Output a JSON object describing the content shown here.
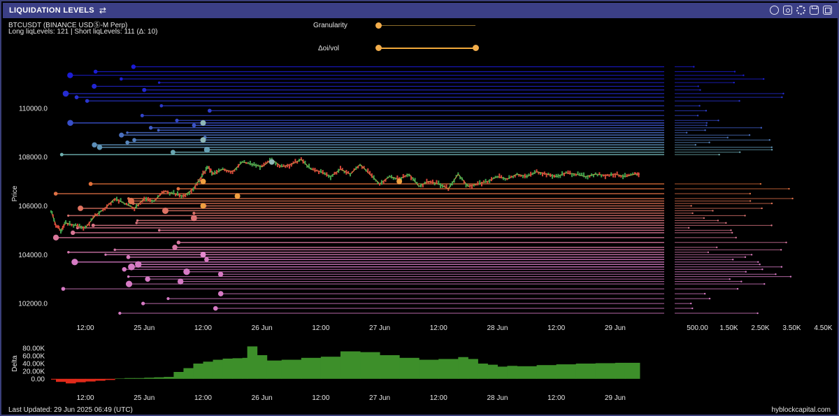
{
  "header": {
    "title": "LIQUIDATION LEVELS",
    "symbol": "BTCUSDT (BINANCE USDⓈ-M Perp)",
    "levels_summary": "Long liqLevels: 121 | Short liqLevels: 111 (Δ: 10)",
    "toolbar_icons": [
      "refresh-icon",
      "camera-icon",
      "gear-icon",
      "save-icon",
      "fullscreen-icon"
    ]
  },
  "controls": {
    "granularity_label": "Granularity",
    "granularity_value": 0.0,
    "oi_vol_label": "Δoi/vol",
    "oi_vol_range": [
      0.0,
      1.0
    ]
  },
  "colors": {
    "accent": "#f2ad4b",
    "short_levels": "#1b1bd6",
    "short_levels_near": "#6fb0b0",
    "long_levels_near": "#e2703a",
    "long_levels_far": "#d67ac4",
    "candle_up": "#3fa34d",
    "candle_down": "#d9463a",
    "delta_positive": "#3d8f2a",
    "delta_negative": "#e02a1a",
    "title_bar": "#3b3f86"
  },
  "chart_data": [
    {
      "type": "line",
      "name": "price",
      "ylabel": "Price",
      "ylim": [
        101200,
        111800
      ],
      "y_ticks": [
        102000,
        104000,
        106000,
        108000,
        110000
      ],
      "y_tick_labels": [
        "102000.0",
        "104000.0",
        "106000.0",
        "108000.0",
        "110000.0"
      ],
      "x_tick_labels": [
        "12:00",
        "25 Jun",
        "12:00",
        "26 Jun",
        "12:00",
        "27 Jun",
        "12:00",
        "28 Jun",
        "12:00",
        "29 Jun"
      ],
      "x_tick_hours": [
        12,
        24,
        36,
        48,
        60,
        72,
        84,
        96,
        108,
        120
      ],
      "x_range_hours": [
        5,
        130
      ],
      "price_path": [
        [
          5,
          105800
        ],
        [
          6,
          105200
        ],
        [
          7,
          105000
        ],
        [
          8,
          105300
        ],
        [
          10,
          105200
        ],
        [
          12,
          105100
        ],
        [
          14,
          105600
        ],
        [
          16,
          105900
        ],
        [
          18,
          106300
        ],
        [
          20,
          106100
        ],
        [
          22,
          105900
        ],
        [
          24,
          106300
        ],
        [
          26,
          106200
        ],
        [
          28,
          106600
        ],
        [
          30,
          106500
        ],
        [
          32,
          106400
        ],
        [
          34,
          106700
        ],
        [
          35,
          107000
        ],
        [
          36,
          107300
        ],
        [
          37,
          107600
        ],
        [
          38,
          107300
        ],
        [
          40,
          107500
        ],
        [
          42,
          107400
        ],
        [
          44,
          107800
        ],
        [
          46,
          107700
        ],
        [
          48,
          107600
        ],
        [
          50,
          107900
        ],
        [
          52,
          107600
        ],
        [
          54,
          107700
        ],
        [
          56,
          107900
        ],
        [
          58,
          107500
        ],
        [
          60,
          107400
        ],
        [
          62,
          107200
        ],
        [
          64,
          107500
        ],
        [
          66,
          107300
        ],
        [
          68,
          107700
        ],
        [
          70,
          107300
        ],
        [
          72,
          106900
        ],
        [
          74,
          107200
        ],
        [
          76,
          107100
        ],
        [
          78,
          107300
        ],
        [
          80,
          106800
        ],
        [
          82,
          107000
        ],
        [
          84,
          106900
        ],
        [
          86,
          106700
        ],
        [
          88,
          107300
        ],
        [
          90,
          106800
        ],
        [
          92,
          106900
        ],
        [
          94,
          107000
        ],
        [
          96,
          107200
        ],
        [
          98,
          107100
        ],
        [
          100,
          107300
        ],
        [
          102,
          107200
        ],
        [
          104,
          107400
        ],
        [
          106,
          107300
        ],
        [
          108,
          107200
        ],
        [
          110,
          107350
        ],
        [
          112,
          107300
        ],
        [
          114,
          107200
        ],
        [
          116,
          107300
        ],
        [
          118,
          107250
        ],
        [
          120,
          107300
        ],
        [
          122,
          107200
        ],
        [
          124,
          107300
        ],
        [
          125,
          107300
        ]
      ],
      "short_levels": [
        111700,
        111500,
        111350,
        111200,
        111050,
        110900,
        110750,
        110600,
        110450,
        110300,
        110100,
        109900,
        109700,
        109500,
        109400,
        109300,
        109200,
        109100,
        109000,
        108900,
        108800,
        108700,
        108600,
        108500,
        108400,
        108300,
        108200,
        108100
      ],
      "long_levels": [
        106900,
        106700,
        106500,
        106300,
        106200,
        106100,
        106000,
        105900,
        105800,
        105700,
        105600,
        105500,
        105400,
        105300,
        105200,
        105100,
        105000,
        104900,
        104700,
        104500,
        104300,
        104200,
        104100,
        104000,
        103900,
        103800,
        103700,
        103600,
        103500,
        103400,
        103300,
        103200,
        103100,
        103000,
        102900,
        102800,
        102600,
        102400,
        102200,
        102000,
        101800,
        101600
      ],
      "side_histogram": {
        "x_tick_labels": [
          "500.00",
          "1.50K",
          "2.50K",
          "3.50K",
          "4.50K"
        ],
        "x_ticks": [
          500,
          1500,
          2500,
          3500,
          4500
        ],
        "xlim": [
          0,
          5000
        ]
      }
    },
    {
      "type": "area",
      "name": "delta",
      "ylabel": "Delta",
      "ylim": [
        -15000,
        95000
      ],
      "y_ticks": [
        0,
        20000,
        40000,
        60000,
        80000
      ],
      "y_tick_labels": [
        "0.00",
        "20.00K",
        "40.00K",
        "60.00K",
        "80.00K"
      ],
      "x_tick_labels": [
        "12:00",
        "25 Jun",
        "12:00",
        "26 Jun",
        "12:00",
        "27 Jun",
        "12:00",
        "28 Jun",
        "12:00",
        "29 Jun"
      ],
      "series": [
        {
          "values": [
            [
              5,
              -2000
            ],
            [
              6,
              -8000
            ],
            [
              8,
              -12000
            ],
            [
              10,
              -9000
            ],
            [
              12,
              -7000
            ],
            [
              14,
              -5000
            ],
            [
              16,
              -3000
            ],
            [
              18,
              1000
            ],
            [
              20,
              2000
            ],
            [
              22,
              2000
            ],
            [
              24,
              3000
            ],
            [
              26,
              4000
            ],
            [
              28,
              5000
            ],
            [
              30,
              18000
            ],
            [
              32,
              28000
            ],
            [
              34,
              40000
            ],
            [
              36,
              45000
            ],
            [
              38,
              50000
            ],
            [
              40,
              53000
            ],
            [
              42,
              54000
            ],
            [
              44,
              55000
            ],
            [
              45,
              85000
            ],
            [
              47,
              62000
            ],
            [
              49,
              48000
            ],
            [
              52,
              50000
            ],
            [
              56,
              55000
            ],
            [
              60,
              58000
            ],
            [
              64,
              72000
            ],
            [
              68,
              70000
            ],
            [
              72,
              62000
            ],
            [
              76,
              55000
            ],
            [
              80,
              50000
            ],
            [
              84,
              52000
            ],
            [
              88,
              57000
            ],
            [
              90,
              52000
            ],
            [
              92,
              40000
            ],
            [
              94,
              37000
            ],
            [
              96,
              32000
            ],
            [
              98,
              34000
            ],
            [
              100,
              33000
            ],
            [
              104,
              36000
            ],
            [
              108,
              38000
            ],
            [
              112,
              40000
            ],
            [
              116,
              41000
            ],
            [
              120,
              42000
            ],
            [
              122,
              42000
            ],
            [
              125,
              42000
            ]
          ]
        }
      ]
    }
  ],
  "footer": {
    "last_updated": "Last Updated: 29 Jun 2025 06:49 (UTC)",
    "brand": "hyblockcapital.com"
  }
}
